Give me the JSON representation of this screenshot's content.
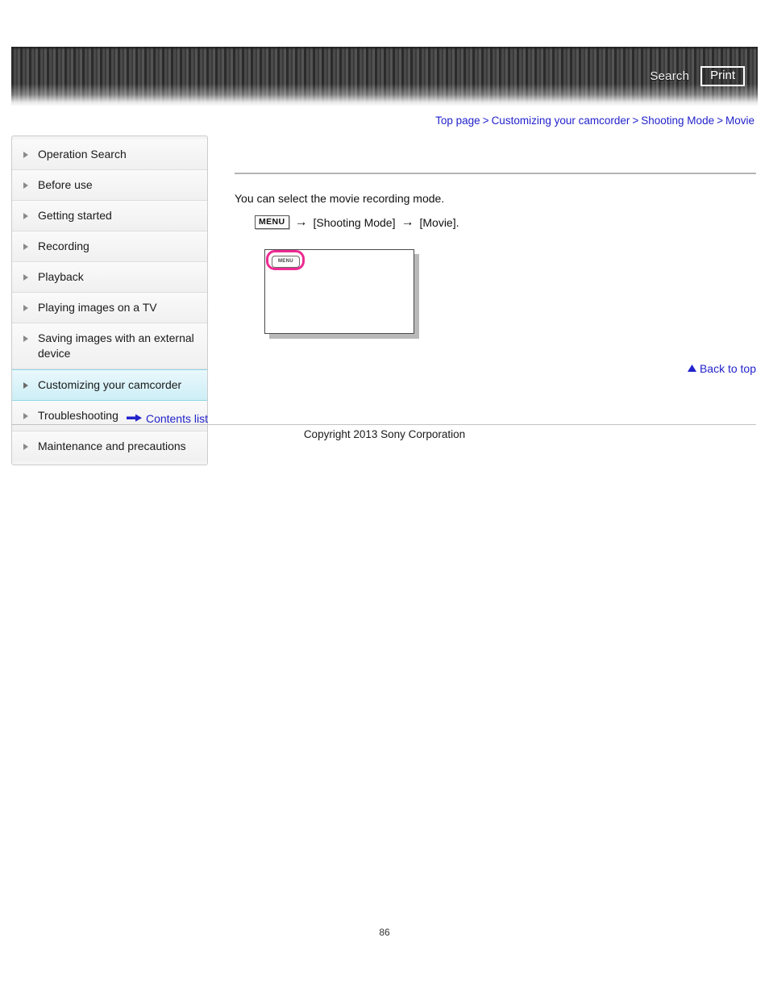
{
  "header": {
    "search_label": "Search",
    "print_label": "Print"
  },
  "breadcrumb": {
    "separator": ">",
    "items": [
      {
        "label": "Top page"
      },
      {
        "label": "Customizing your camcorder"
      },
      {
        "label": "Shooting Mode"
      },
      {
        "label": "Movie"
      }
    ]
  },
  "sidebar": {
    "items": [
      {
        "label": "Operation Search",
        "selected": false
      },
      {
        "label": "Before use",
        "selected": false
      },
      {
        "label": "Getting started",
        "selected": false
      },
      {
        "label": "Recording",
        "selected": false
      },
      {
        "label": "Playback",
        "selected": false
      },
      {
        "label": "Playing images on a TV",
        "selected": false
      },
      {
        "label": "Saving images with an external device",
        "selected": false
      },
      {
        "label": "Customizing your camcorder",
        "selected": true
      },
      {
        "label": "Troubleshooting",
        "selected": false
      },
      {
        "label": "Maintenance and precautions",
        "selected": false
      }
    ],
    "contents_list_label": "Contents list"
  },
  "main": {
    "title": "",
    "intro_text": "You can select the movie recording mode.",
    "operation": {
      "menu_chip_label": "MENU",
      "arrow": "→",
      "step_one": "[Shooting Mode]",
      "step_two": "[Movie]."
    },
    "illustration": {
      "menu_chip_label": "MENU"
    },
    "back_to_top_label": "Back to top"
  },
  "footer": {
    "copyright": "Copyright 2013 Sony Corporation",
    "page_number": "86"
  },
  "colors": {
    "link_blue": "#2222cc",
    "highlight_pink": "#ec2b92",
    "selected_nav_cyan": "#cdeef6",
    "banner_dark": "#3a3a3a"
  }
}
